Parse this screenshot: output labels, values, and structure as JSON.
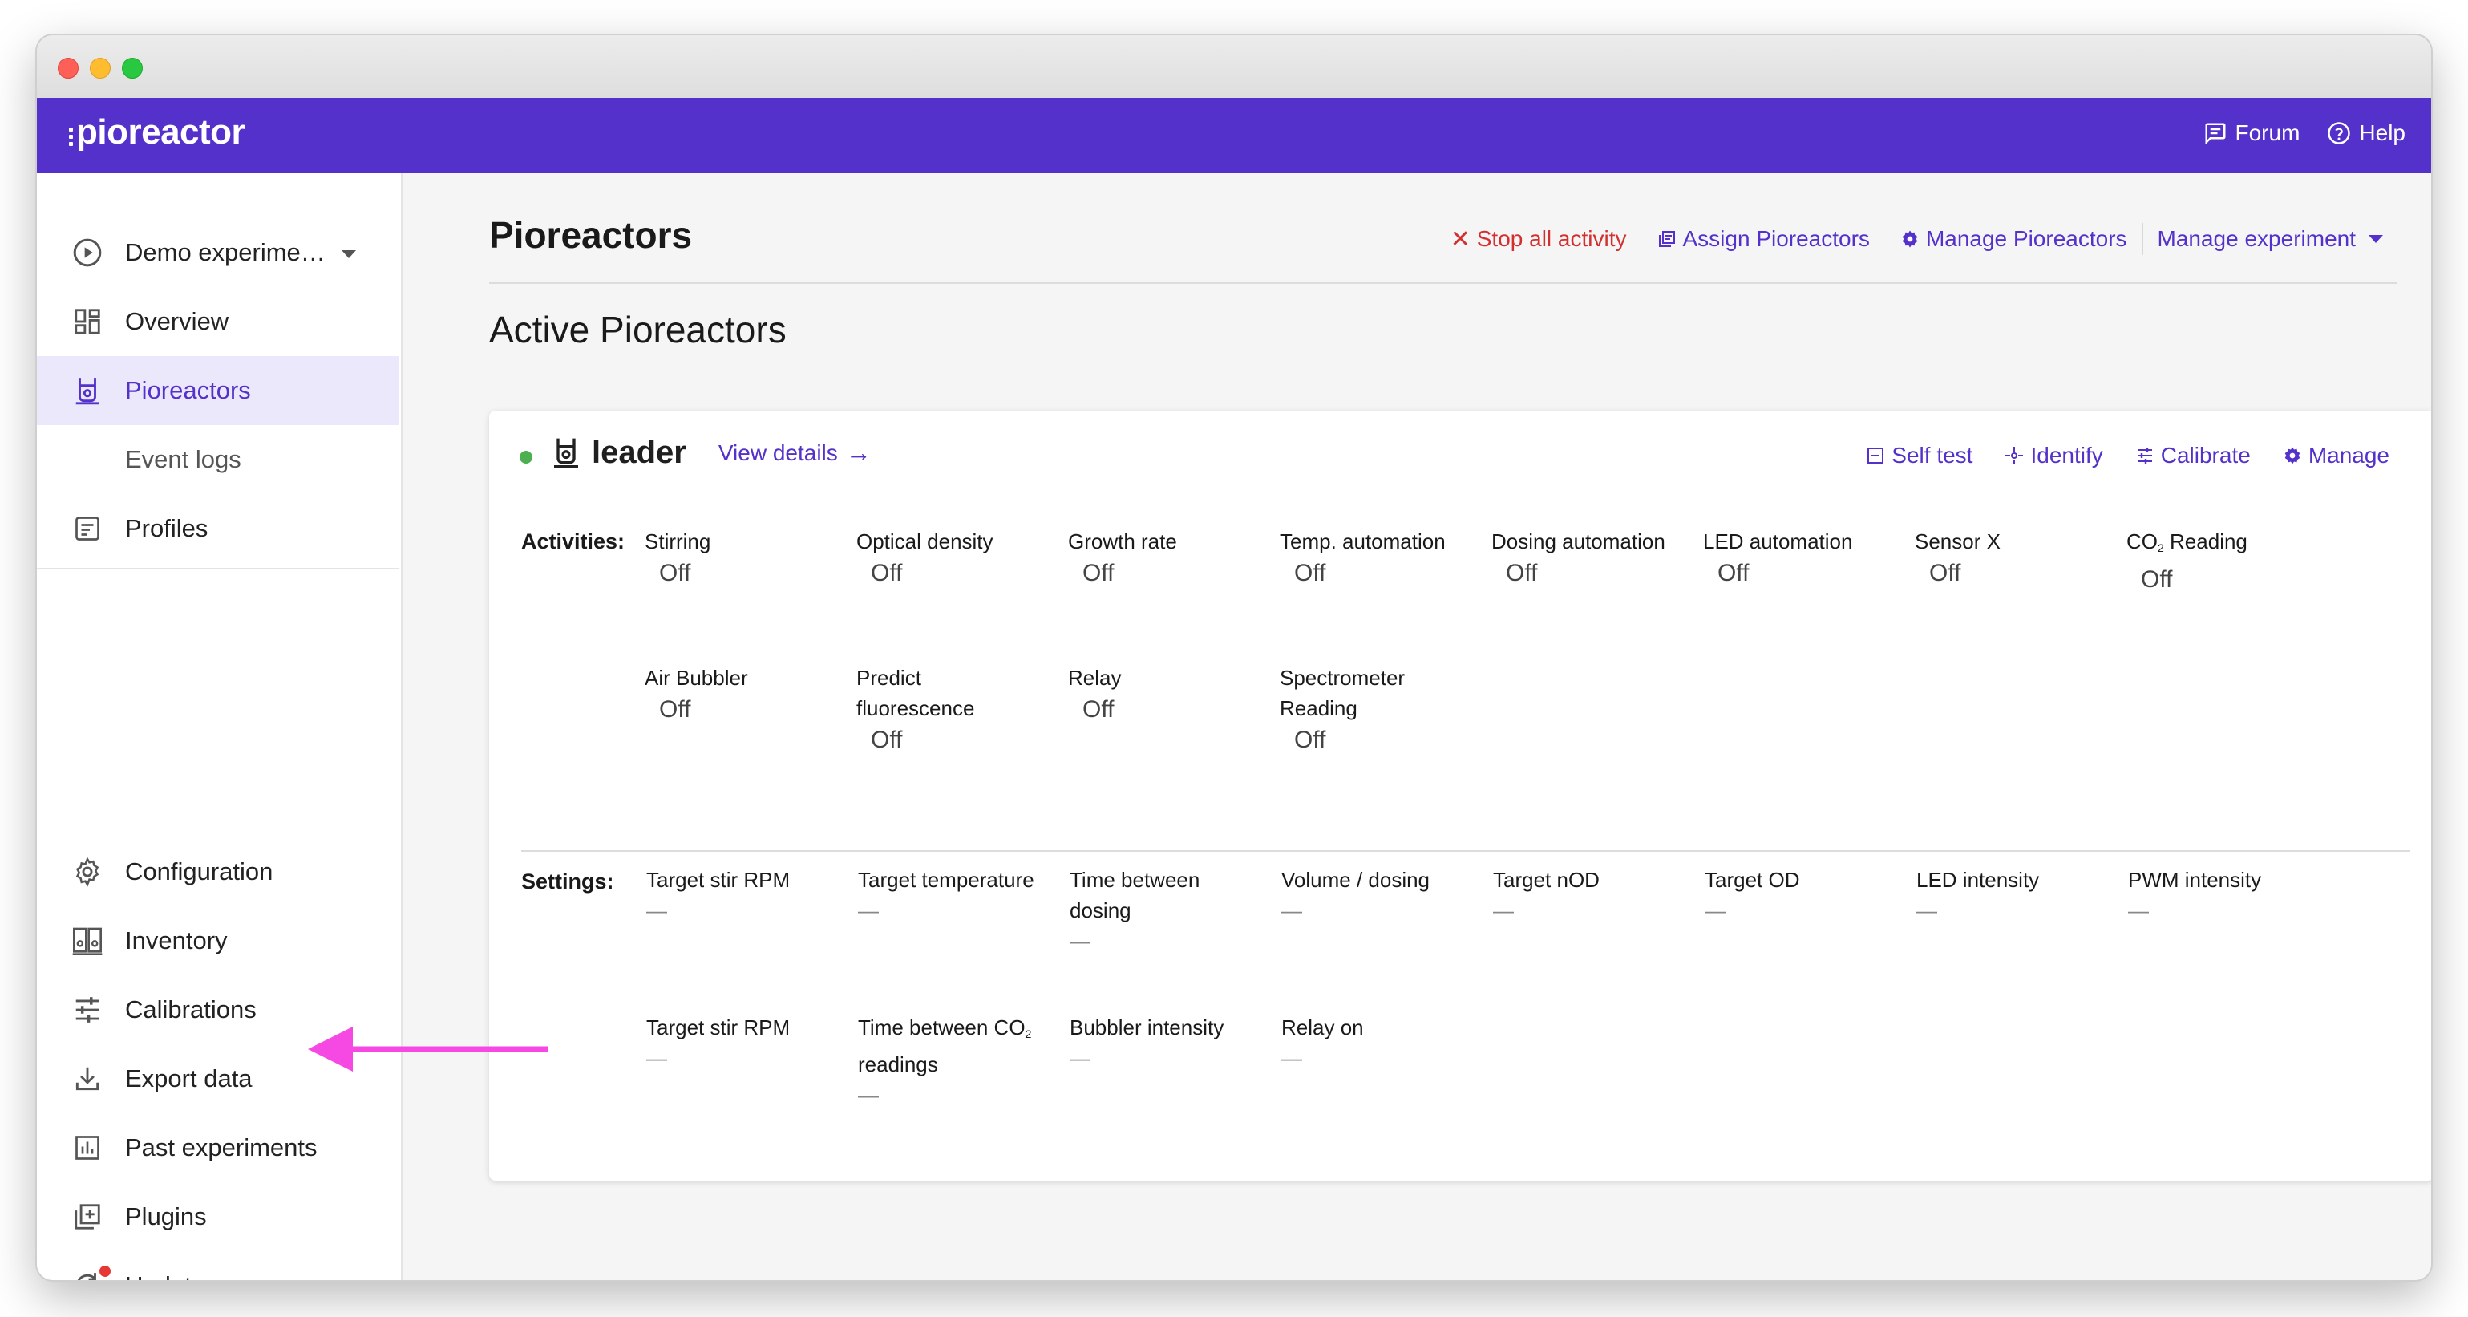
{
  "header": {
    "logo": "pioreactor",
    "forum_label": "Forum",
    "help_label": "Help"
  },
  "sidebar": {
    "experiment": "Demo experime…",
    "items": [
      {
        "label": "Overview",
        "icon": "dashboard-icon"
      },
      {
        "label": "Pioreactors",
        "icon": "pioreactor-icon",
        "active": true
      },
      {
        "label": "Event logs"
      },
      {
        "label": "Profiles",
        "icon": "profile-icon"
      }
    ],
    "bottom_items": [
      {
        "label": "Configuration",
        "icon": "gear-icon"
      },
      {
        "label": "Inventory",
        "icon": "inventory-icon"
      },
      {
        "label": "Calibrations",
        "icon": "tune-icon"
      },
      {
        "label": "Export data",
        "icon": "download-icon"
      },
      {
        "label": "Past experiments",
        "icon": "chart-icon"
      },
      {
        "label": "Plugins",
        "icon": "plugin-icon"
      },
      {
        "label": "Updates",
        "icon": "update-icon"
      }
    ]
  },
  "main": {
    "title": "Pioreactors",
    "actions": {
      "stop": "Stop all activity",
      "assign": "Assign Pioreactors",
      "manage": "Manage Pioreactors",
      "manage_experiment": "Manage experiment"
    },
    "section_title": "Active Pioreactors"
  },
  "card": {
    "unit_name": "leader",
    "view_details": "View details",
    "actions": {
      "self_test": "Self test",
      "identify": "Identify",
      "calibrate": "Calibrate",
      "manage": "Manage"
    },
    "activities_label": "Activities:",
    "activities": [
      {
        "name": "Stirring",
        "value": "Off"
      },
      {
        "name": "Optical density",
        "value": "Off"
      },
      {
        "name": "Growth rate",
        "value": "Off"
      },
      {
        "name": "Temp. automation",
        "value": "Off"
      },
      {
        "name": "Dosing automation",
        "value": "Off"
      },
      {
        "name": "LED automation",
        "value": "Off"
      },
      {
        "name": "Sensor X",
        "value": "Off"
      },
      {
        "name": "Reading",
        "prefix": "CO",
        "sub": "2",
        "value": "Off"
      },
      {
        "name": "Air Bubbler",
        "value": "Off"
      },
      {
        "name": "Predict fluorescence",
        "value": "Off"
      },
      {
        "name": "Relay",
        "value": "Off"
      },
      {
        "name": "Spectrometer Reading",
        "value": "Off"
      }
    ],
    "settings_label": "Settings:",
    "settings": [
      {
        "name": "Target stir RPM",
        "value": "—"
      },
      {
        "name": "Target temperature",
        "value": "—"
      },
      {
        "name": "Time between dosing",
        "value": "—"
      },
      {
        "name": "Volume / dosing",
        "value": "—"
      },
      {
        "name": "Target nOD",
        "value": "—"
      },
      {
        "name": "Target OD",
        "value": "—"
      },
      {
        "name": "LED intensity",
        "value": "—"
      },
      {
        "name": "PWM intensity",
        "value": "—"
      },
      {
        "name": "Target stir RPM",
        "value": "—"
      },
      {
        "name": "Time between CO",
        "sub": "2",
        "suffix": " readings",
        "value": "—"
      },
      {
        "name": "Bubbler intensity",
        "value": "—"
      },
      {
        "name": "Relay on",
        "value": "—"
      }
    ]
  },
  "colors": {
    "brand": "#5331ca",
    "danger": "#d32f2f",
    "active_bg": "#ece8fb",
    "status": "#4caf50",
    "annotation_arrow": "#f649e3"
  }
}
